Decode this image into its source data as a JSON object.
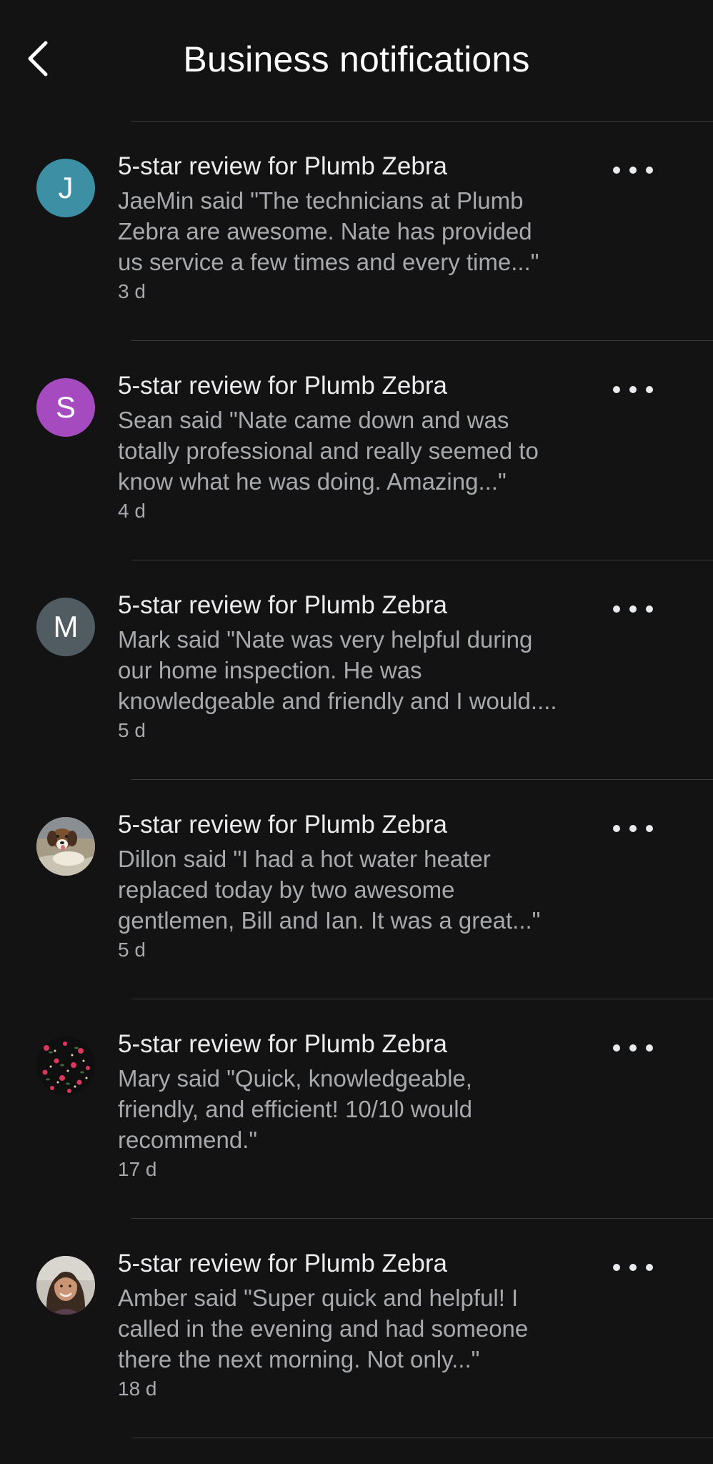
{
  "header": {
    "title": "Business notifications",
    "back_icon": "chevron-left-icon"
  },
  "notifications": [
    {
      "avatar": {
        "type": "initial",
        "initial": "J",
        "color": "#3d8fa3"
      },
      "title": "5-star review for Plumb Zebra",
      "body": "JaeMin said \"The technicians at Plumb\nZebra are awesome. Nate has provided\nus service a few times and every time...\"",
      "time": "3 d"
    },
    {
      "avatar": {
        "type": "initial",
        "initial": "S",
        "color": "#a54bbf"
      },
      "title": "5-star review for Plumb Zebra",
      "body": "Sean said \"Nate came down and was\ntotally professional and really seemed to\nknow what he was doing. Amazing...\"",
      "time": "4 d"
    },
    {
      "avatar": {
        "type": "initial",
        "initial": "M",
        "color": "#505b62"
      },
      "title": "5-star review for Plumb Zebra",
      "body": "Mark said \"Nate was very helpful during\nour home inspection.  He was\nknowledgeable and friendly and I would....",
      "time": "5 d"
    },
    {
      "avatar": {
        "type": "photo",
        "photo": "dog-photo"
      },
      "title": "5-star review for Plumb Zebra",
      "body": "Dillon said \"I had a hot water heater\nreplaced today by two awesome\ngentlemen,  Bill and Ian. It was a great...\"",
      "time": "5 d"
    },
    {
      "avatar": {
        "type": "photo",
        "photo": "floral-pattern-photo"
      },
      "title": "5-star review for Plumb Zebra",
      "body": "Mary said \"Quick, knowledgeable,\nfriendly, and efficient! 10/10 would\nrecommend.\"",
      "time": "17 d"
    },
    {
      "avatar": {
        "type": "photo",
        "photo": "woman-portrait-photo"
      },
      "title": "5-star review for Plumb Zebra",
      "body": "Amber said \"Super quick and helpful! I\ncalled in the evening and had someone\nthere the next morning. Not only...\"",
      "time": "18 d"
    }
  ],
  "more_icon": "more-horizontal-icon",
  "colors": {
    "background": "#131314",
    "divider": "#3a3b3d",
    "title_text": "#ececee",
    "secondary_text": "#a7a9ac"
  }
}
